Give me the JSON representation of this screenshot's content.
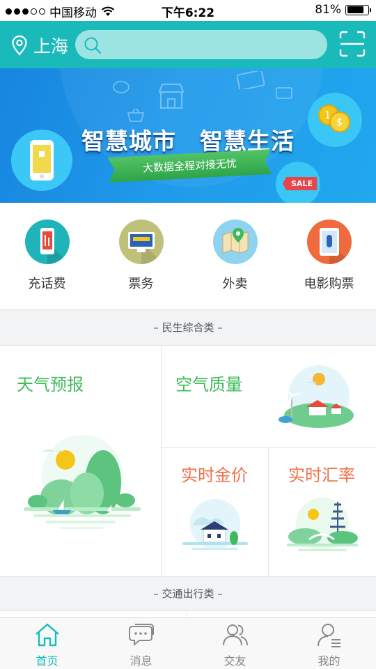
{
  "status_bar": {
    "carrier": "中国移动",
    "time": "下午6:22",
    "battery": "81%",
    "battery_level": 0.81
  },
  "header": {
    "city": "上海",
    "search_placeholder": ""
  },
  "banner": {
    "title": "智慧城市　智慧生活",
    "subtitle": "大数据全程对接无忧",
    "sale_tag": "SALE"
  },
  "services": [
    {
      "label": "充话费",
      "icon": "phone-recharge-icon",
      "color": "#1fb5b8"
    },
    {
      "label": "票务",
      "icon": "ticket-icon",
      "color": "#bfc17a"
    },
    {
      "label": "外卖",
      "icon": "takeout-map-icon",
      "color": "#8fd3ef"
    },
    {
      "label": "电影购票",
      "icon": "movie-ticket-icon",
      "color": "#ef6a3c"
    }
  ],
  "sections": {
    "livelihood": "– 民生综合类 –",
    "traffic": "– 交通出行类 –"
  },
  "grid": {
    "weather": "天气预报",
    "air": "空气质量",
    "gold": "实时金价",
    "exchange": "实时汇率"
  },
  "tabbar": [
    {
      "label": "首页",
      "icon": "home-icon",
      "active": true
    },
    {
      "label": "消息",
      "icon": "message-icon",
      "active": false
    },
    {
      "label": "交友",
      "icon": "friends-icon",
      "active": false
    },
    {
      "label": "我的",
      "icon": "profile-icon",
      "active": false
    }
  ],
  "colors": {
    "primary": "#1ab9ba",
    "green_title": "#3fba5a",
    "orange_title": "#f0724a"
  }
}
